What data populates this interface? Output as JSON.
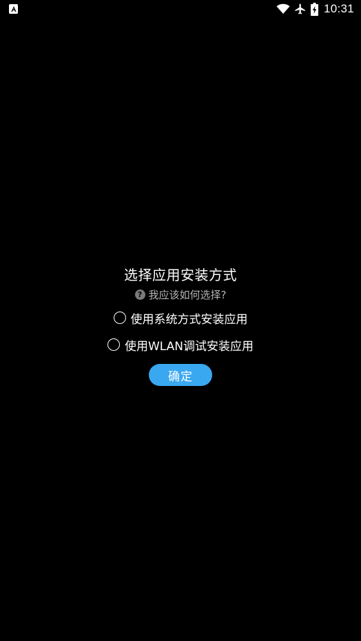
{
  "status_bar": {
    "notification_icon": "a-icon",
    "icons": [
      "wifi-icon",
      "airplane-mode-icon",
      "battery-charging-icon"
    ],
    "time": "10:31"
  },
  "dialog": {
    "title": "选择应用安装方式",
    "help_icon": "question-circle-icon",
    "help_text": "我应该如何选择?",
    "options": [
      {
        "label": "使用系统方式安装应用",
        "selected": false
      },
      {
        "label": "使用WLAN调试安装应用",
        "selected": false
      }
    ],
    "confirm_label": "确定"
  },
  "colors": {
    "background": "#000000",
    "accent": "#3aa8f0",
    "text_primary": "#ffffff",
    "text_secondary": "#b5b5b5"
  }
}
